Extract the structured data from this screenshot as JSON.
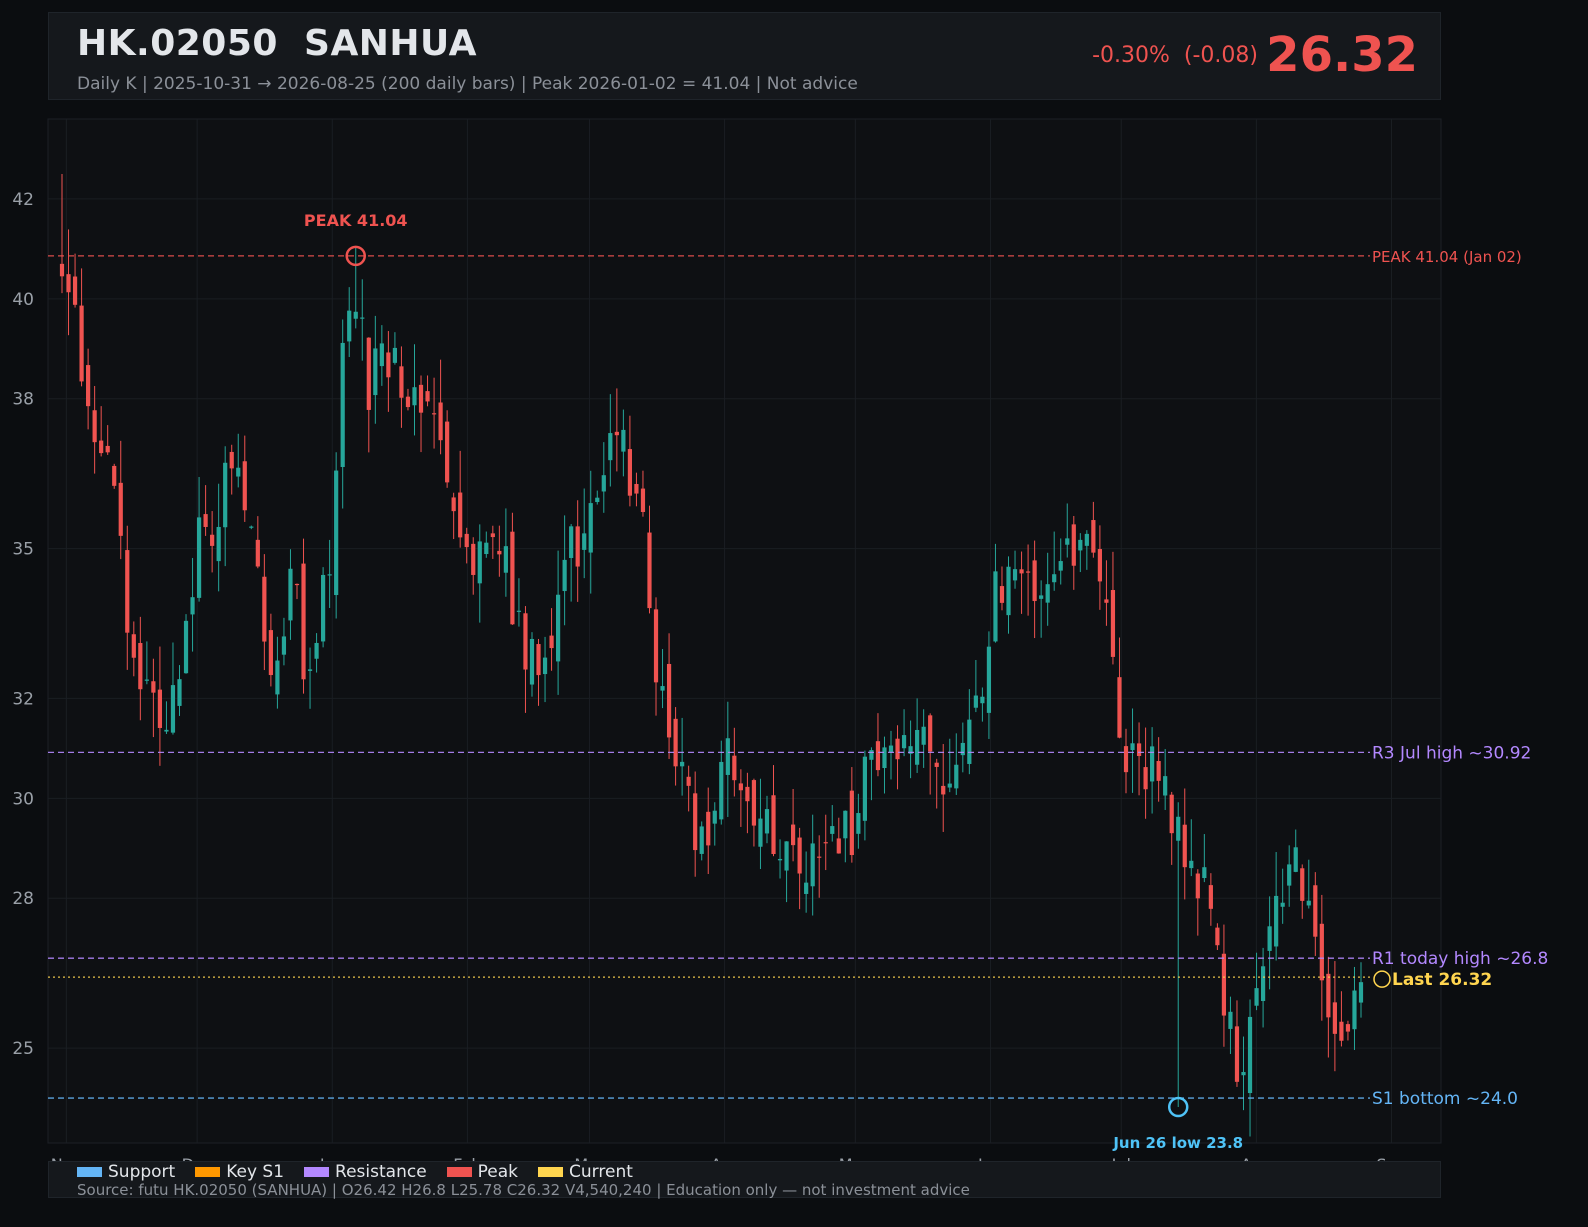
{
  "header": {
    "title": "HK.02050  SANHUA",
    "subtitle": "Daily K  |  2025-10-31 → 2026-08-25 (200 daily bars)  |  Peak 2026-01-02 = 41.04  |  Not advice",
    "change": "-0.30%  (-0.08)",
    "price": "26.32"
  },
  "footer": {
    "legend": [
      {
        "label": "Support",
        "color": "#64b5f6"
      },
      {
        "label": "Key S1",
        "color": "#ff9800"
      },
      {
        "label": "Resistance",
        "color": "#b388ff"
      },
      {
        "label": "Peak",
        "color": "#ef5350"
      },
      {
        "label": "Current",
        "color": "#ffd54f"
      }
    ],
    "source": "Source: futu HK.02050 (SANHUA)  |  O26.42  H26.8  L25.78  C26.32  V4,540,240  |  Education only — not investment advice"
  },
  "chart_data": {
    "type": "candlestick",
    "x_range": [
      "2025-10-31",
      "2026-08-25"
    ],
    "bar_count": 200,
    "y_ticks": [
      25,
      28,
      30,
      32,
      35,
      38,
      40,
      42
    ],
    "x_ticks": [
      "Nov",
      "Dec",
      "Jan",
      "Feb",
      "Mar",
      "Apr",
      "May",
      "Jun",
      "Jul",
      "Aug",
      "Sep"
    ],
    "ylim": [
      23.1,
      43.6
    ],
    "grid": true,
    "colors": {
      "up": "#26a69a",
      "down": "#ef5350"
    },
    "levels": [
      {
        "name": "peak",
        "value": 40.86,
        "label": "PEAK 41.04 (Jan 02)",
        "color": "#ef5350",
        "style": "dashed"
      },
      {
        "name": "r3",
        "value": 30.92,
        "label": "R3 Jul high ~30.92",
        "color": "#b388ff",
        "style": "dashed"
      },
      {
        "name": "r1",
        "value": 26.8,
        "label": "R1 today high ~26.8",
        "color": "#b388ff",
        "style": "dashed"
      },
      {
        "name": "current",
        "value": 26.42,
        "label": "Last 26.32",
        "color": "#ffd54f",
        "style": "dotted"
      },
      {
        "name": "s1",
        "value": 24.0,
        "label": "S1 bottom ~24.0",
        "color": "#64b5f6",
        "style": "dashed"
      }
    ],
    "annotations": [
      {
        "text": "PEAK 41.04",
        "color": "#ef5350"
      },
      {
        "text": "Jun 26 low 23.8",
        "color": "#4fc3f7"
      }
    ],
    "peak_marker": {
      "date_index": 45,
      "value": 40.86
    },
    "low_marker": {
      "date_index": 171,
      "value": 23.82
    },
    "waypoints": [
      [
        0,
        40.3
      ],
      [
        2,
        39.9
      ],
      [
        4,
        37.5
      ],
      [
        8,
        36.7
      ],
      [
        10,
        33.8
      ],
      [
        13,
        32.0
      ],
      [
        15,
        31.3
      ],
      [
        17,
        31.9
      ],
      [
        19,
        33.2
      ],
      [
        21,
        35.3
      ],
      [
        23,
        34.8
      ],
      [
        25,
        36.4
      ],
      [
        27,
        36.7
      ],
      [
        29,
        35.8
      ],
      [
        31,
        33.6
      ],
      [
        33,
        32.4
      ],
      [
        35,
        34.6
      ],
      [
        37,
        32.9
      ],
      [
        39,
        33.3
      ],
      [
        41,
        35.0
      ],
      [
        43,
        38.6
      ],
      [
        45,
        40.0
      ],
      [
        47,
        38.2
      ],
      [
        49,
        39.4
      ],
      [
        51,
        38.5
      ],
      [
        53,
        38.3
      ],
      [
        55,
        38.1
      ],
      [
        57,
        37.4
      ],
      [
        59,
        36.6
      ],
      [
        61,
        35.7
      ],
      [
        63,
        35.0
      ],
      [
        65,
        34.6
      ],
      [
        67,
        35.1
      ],
      [
        69,
        34.0
      ],
      [
        71,
        32.5
      ],
      [
        73,
        32.8
      ],
      [
        75,
        33.4
      ],
      [
        77,
        34.9
      ],
      [
        79,
        35.1
      ],
      [
        81,
        35.7
      ],
      [
        83,
        36.2
      ],
      [
        85,
        37.5
      ],
      [
        87,
        36.6
      ],
      [
        89,
        35.2
      ],
      [
        91,
        32.7
      ],
      [
        93,
        31.3
      ],
      [
        95,
        30.8
      ],
      [
        97,
        29.5
      ],
      [
        99,
        29.3
      ],
      [
        101,
        30.8
      ],
      [
        103,
        30.7
      ],
      [
        105,
        29.5
      ],
      [
        107,
        29.8
      ],
      [
        109,
        29.4
      ],
      [
        111,
        29.0
      ],
      [
        113,
        28.6
      ],
      [
        115,
        28.7
      ],
      [
        117,
        28.8
      ],
      [
        119,
        29.4
      ],
      [
        121,
        29.4
      ],
      [
        123,
        30.6
      ],
      [
        125,
        30.5
      ],
      [
        127,
        30.7
      ],
      [
        129,
        31.0
      ],
      [
        131,
        31.6
      ],
      [
        133,
        30.8
      ],
      [
        135,
        30.4
      ],
      [
        137,
        30.6
      ],
      [
        139,
        31.3
      ],
      [
        141,
        32.1
      ],
      [
        143,
        34.3
      ],
      [
        145,
        34.6
      ],
      [
        147,
        34.2
      ],
      [
        149,
        34.4
      ],
      [
        151,
        34.5
      ],
      [
        153,
        34.7
      ],
      [
        155,
        35.2
      ],
      [
        157,
        35.4
      ],
      [
        159,
        34.8
      ],
      [
        161,
        32.5
      ],
      [
        163,
        30.9
      ],
      [
        165,
        30.6
      ],
      [
        167,
        30.7
      ],
      [
        169,
        30.0
      ],
      [
        171,
        29.3
      ],
      [
        173,
        28.9
      ],
      [
        175,
        28.1
      ],
      [
        177,
        26.9
      ],
      [
        179,
        25.4
      ],
      [
        181,
        24.3
      ],
      [
        183,
        26.1
      ],
      [
        185,
        27.5
      ],
      [
        187,
        28.0
      ],
      [
        189,
        28.5
      ],
      [
        191,
        27.8
      ],
      [
        193,
        26.4
      ],
      [
        195,
        25.7
      ],
      [
        197,
        25.1
      ],
      [
        199,
        26.32
      ]
    ]
  }
}
